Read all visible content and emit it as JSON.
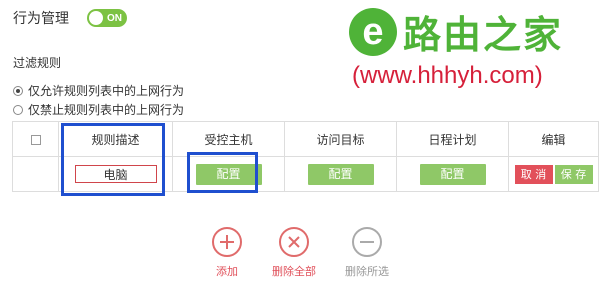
{
  "header": {
    "section_title": "行为管理",
    "toggle_label": "ON"
  },
  "logo": {
    "glyph": "e",
    "brand": "路由之家",
    "url": "(www.hhhyh.com)"
  },
  "filter": {
    "title": "过滤规则",
    "options": [
      {
        "label": "仅允许规则列表中的上网行为",
        "checked": true
      },
      {
        "label": "仅禁止规则列表中的上网行为",
        "checked": false
      }
    ]
  },
  "table": {
    "headers": [
      "规则描述",
      "受控主机",
      "访问目标",
      "日程计划",
      "编辑"
    ],
    "row": {
      "description": "电脑",
      "host_button": "配置",
      "target_button": "配置",
      "schedule_button": "配置",
      "cancel_button": "取 消",
      "save_button": "保 存"
    }
  },
  "actions": {
    "add": "添加",
    "delete_all": "删除全部",
    "delete_selected": "删除所选"
  },
  "colors": {
    "green": "#8fc867",
    "red": "#e2505a",
    "highlight": "#1f4fcf"
  }
}
